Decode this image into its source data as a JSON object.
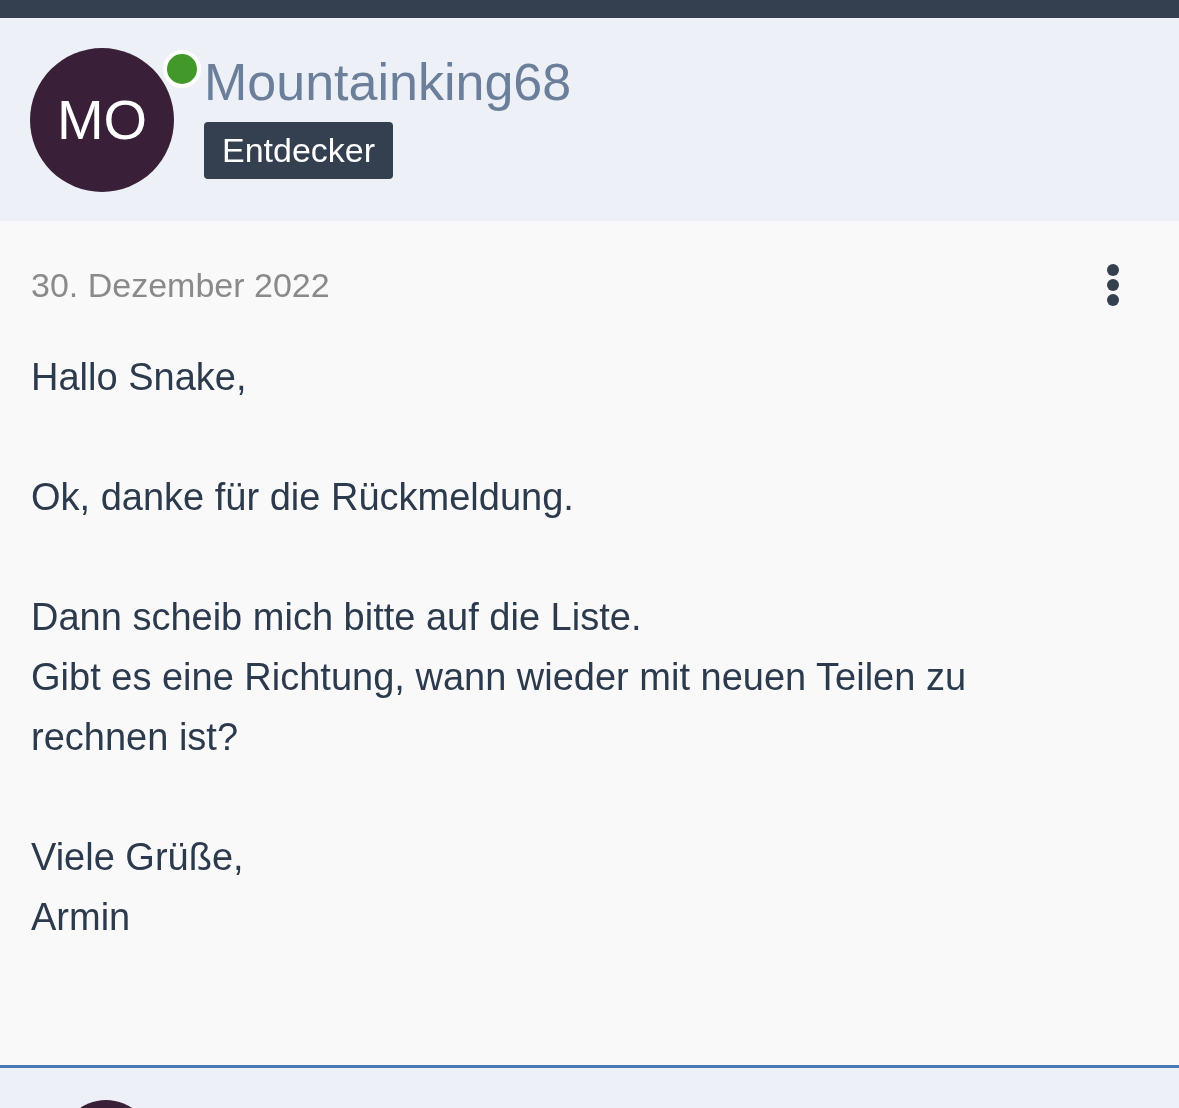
{
  "post": {
    "author": "Mountainking68",
    "avatar_initials": "MO",
    "online": true,
    "rank": "Entdecker",
    "date": "30. Dezember 2022",
    "paragraphs": [
      [
        "Hallo Snake,"
      ],
      [
        "Ok, danke für die Rückmeldung."
      ],
      [
        "Dann scheib mich bitte auf die Liste.",
        "Gibt es eine Richtung, wann wieder mit neuen Teilen zu rechnen ist?"
      ],
      [
        "Viele Grüße,",
        "Armin"
      ]
    ]
  }
}
